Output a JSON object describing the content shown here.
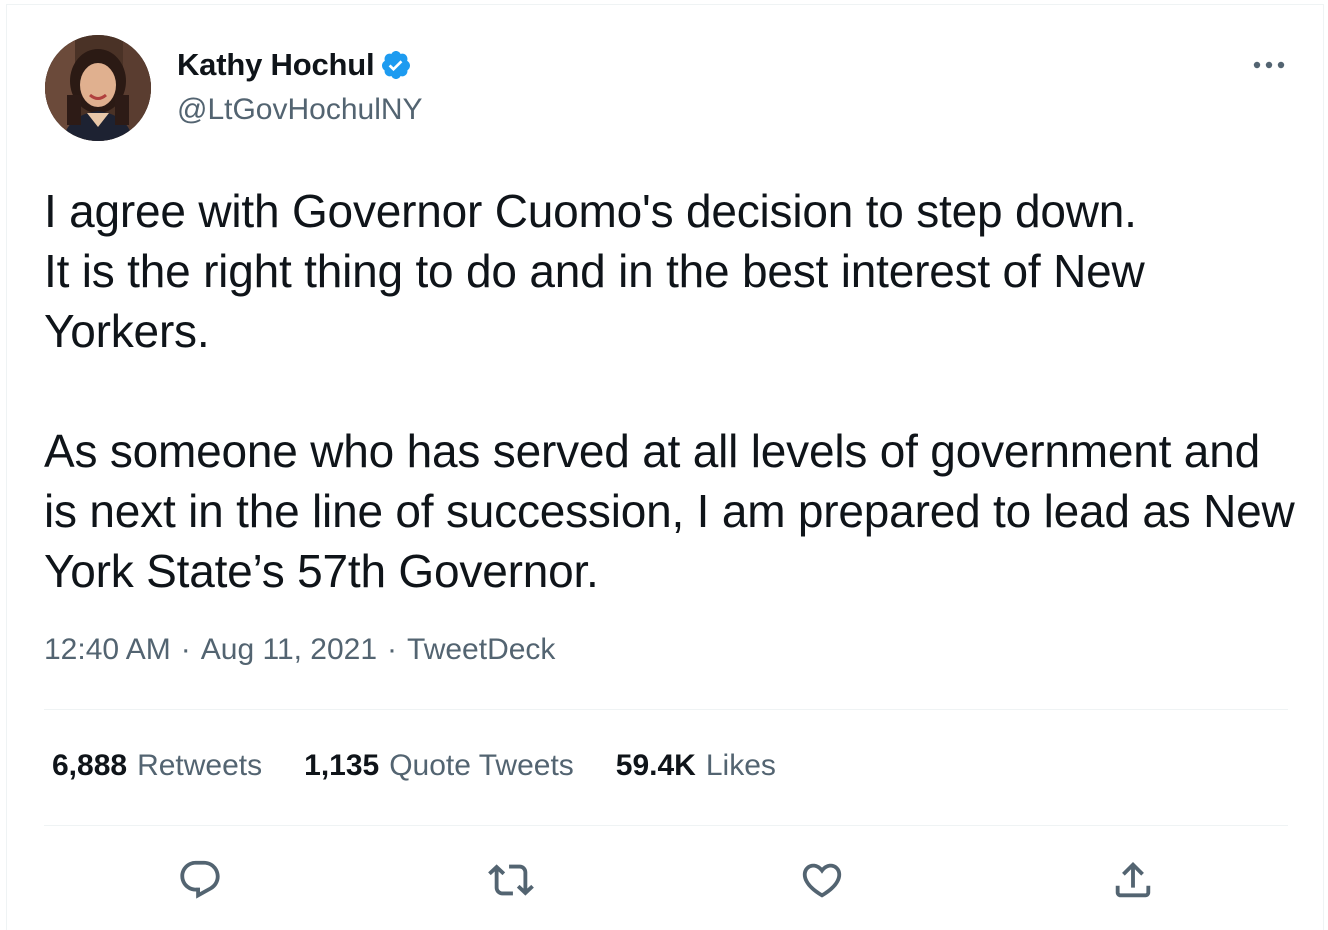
{
  "author": {
    "display_name": "Kathy Hochul",
    "handle": "@LtGovHochulNY",
    "avatar_icon": "profile-photo",
    "verified_icon": "verified-badge-icon"
  },
  "tweet": {
    "paragraphs": [
      "I agree with Governor Cuomo's decision to step down.\nIt is the right thing to do and in the best interest of New Yorkers.",
      "As someone who has served at all levels of government and is next in the line of succession, I am prepared to lead as New York State’s 57th Governor."
    ],
    "time": "12:40 AM",
    "date": "Aug 11, 2021",
    "separator": "·",
    "source": "TweetDeck"
  },
  "stats": {
    "retweets": {
      "count": "6,888",
      "label": "Retweets"
    },
    "quotes": {
      "count": "1,135",
      "label": "Quote Tweets"
    },
    "likes": {
      "count": "59.4K",
      "label": "Likes"
    }
  },
  "actions": [
    "reply-icon",
    "retweet-icon",
    "like-icon",
    "share-icon"
  ],
  "colors": {
    "text_primary": "#0f1419",
    "text_secondary": "#536471",
    "verified_blue": "#1d9bf0",
    "divider": "#eff3f4"
  }
}
